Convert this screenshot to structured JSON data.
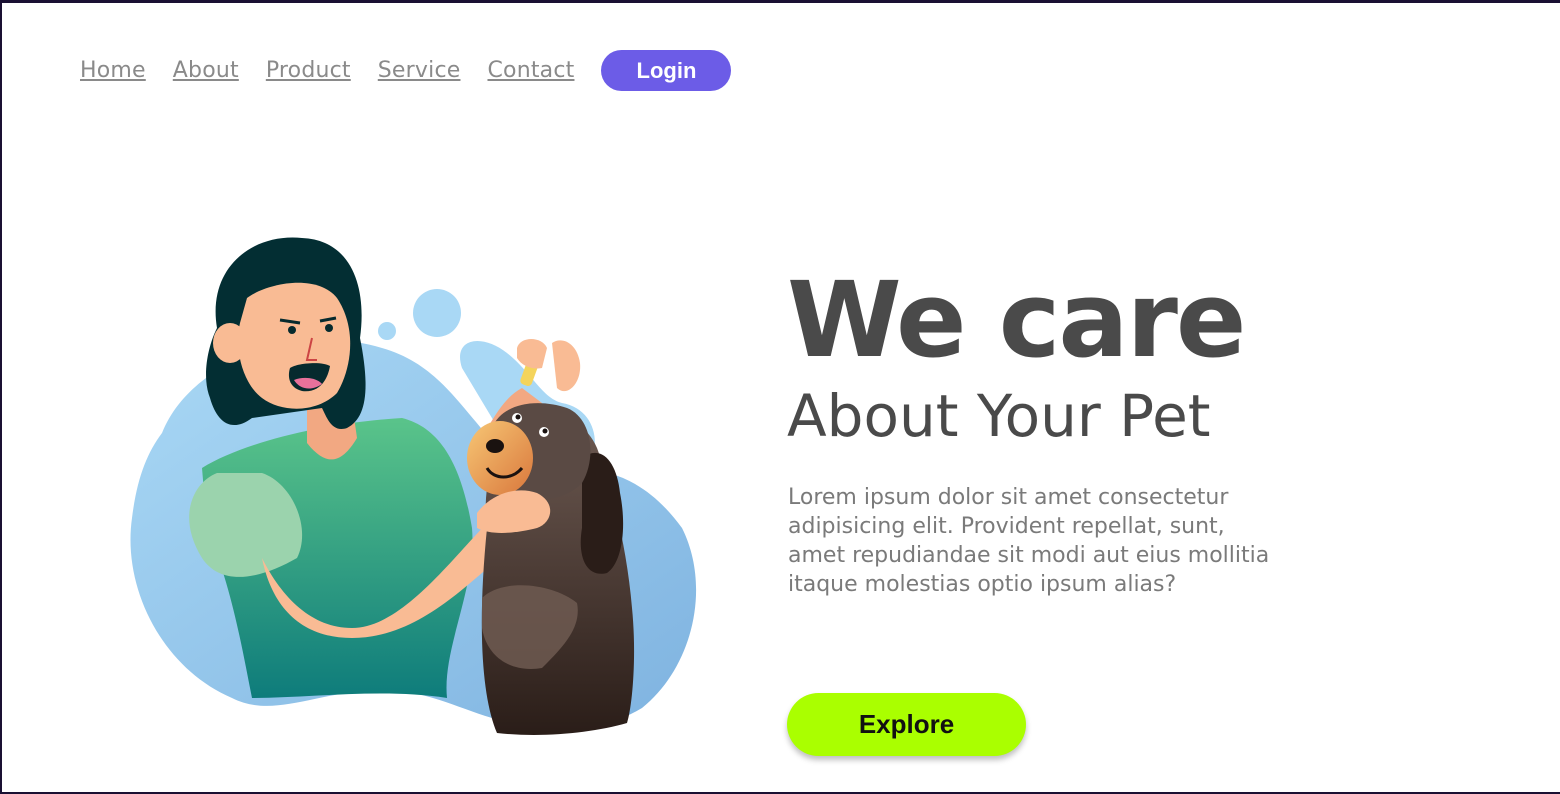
{
  "nav": {
    "links": [
      "Home",
      "About",
      "Product",
      "Service",
      "Contact"
    ],
    "login_label": "Login"
  },
  "hero": {
    "title": "We care",
    "subtitle": "About Your Pet",
    "description": "Lorem ipsum dolor sit amet consectetur adipisicing elit. Provident repellat, sunt, amet repudiandae sit modi aut eius mollitia itaque molestias optio ipsum alias?",
    "cta_label": "Explore",
    "illustration": "woman-caring-for-dog-illustration"
  },
  "colors": {
    "login_button": "#6c5ce7",
    "cta_button": "#aaff00",
    "text_dark": "#4a4a4a",
    "text_muted": "#7a7a7a",
    "blob_blue": "#8cc4ea"
  }
}
